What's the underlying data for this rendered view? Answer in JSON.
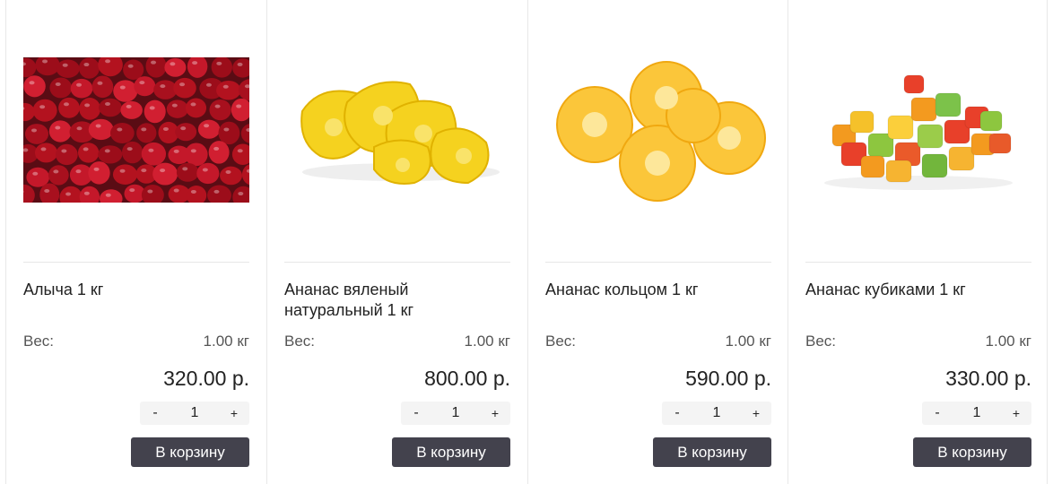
{
  "products": [
    {
      "image": "dried-cherry-plum-image",
      "title": "Алыча 1 кг",
      "weight_label": "Вес:",
      "weight_value": "1.00 кг",
      "price": "320.00 р.",
      "qty_minus": "-",
      "qty_value": "1",
      "qty_plus": "+",
      "cart_label": "В корзину"
    },
    {
      "image": "dried-pineapple-natural-image",
      "title": "Ананас вяленый натуральный 1 кг",
      "weight_label": "Вес:",
      "weight_value": "1.00 кг",
      "price": "800.00 р.",
      "qty_minus": "-",
      "qty_value": "1",
      "qty_plus": "+",
      "cart_label": "В корзину"
    },
    {
      "image": "pineapple-rings-image",
      "title": "Ананас кольцом 1 кг",
      "weight_label": "Вес:",
      "weight_value": "1.00 кг",
      "price": "590.00 р.",
      "qty_minus": "-",
      "qty_value": "1",
      "qty_plus": "+",
      "cart_label": "В корзину"
    },
    {
      "image": "pineapple-cubes-image",
      "title": "Ананас кубиками 1 кг",
      "weight_label": "Вес:",
      "weight_value": "1.00 кг",
      "price": "330.00 р.",
      "qty_minus": "-",
      "qty_value": "1",
      "qty_plus": "+",
      "cart_label": "В корзину"
    }
  ],
  "colors": {
    "button_bg": "#43424d",
    "button_text": "#ffffff",
    "border": "#e8e8e8",
    "qty_bg": "#f4f4f4"
  }
}
